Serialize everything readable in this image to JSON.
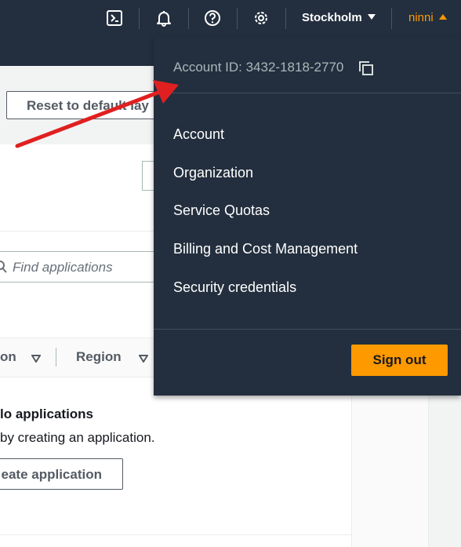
{
  "nav": {
    "icons": [
      "cloudshell-icon",
      "bell-icon",
      "help-icon",
      "gear-icon"
    ],
    "region": "Stockholm",
    "user": "ninni"
  },
  "page": {
    "reset_button": "Reset to default lay",
    "search_placeholder": "Find applications",
    "table_columns": [
      "on",
      "Region"
    ],
    "empty_title": "lo applications",
    "empty_desc": "by creating an application.",
    "create_button": "eate application"
  },
  "dropdown": {
    "account_id_label": "Account ID: 3432-1818-2770",
    "items": [
      "Account",
      "Organization",
      "Service Quotas",
      "Billing and Cost Management",
      "Security credentials"
    ],
    "signout": "Sign out"
  },
  "colors": {
    "nav_bg": "#232f3e",
    "accent": "#ff9900",
    "arrow": "#e02020"
  }
}
